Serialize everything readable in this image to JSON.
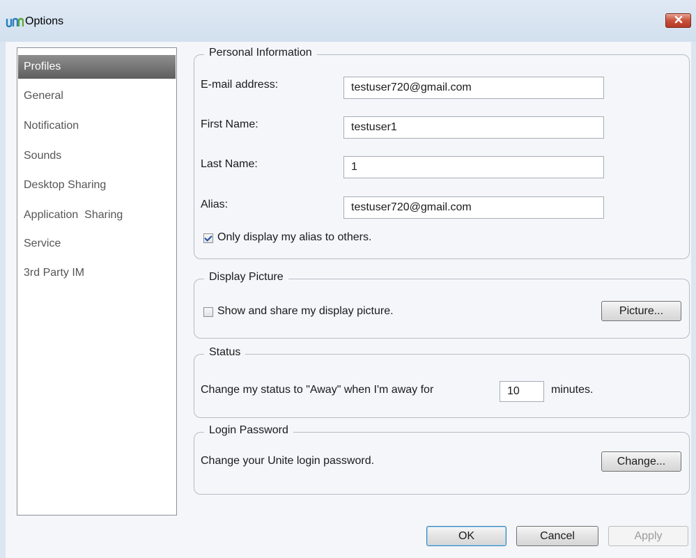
{
  "window": {
    "title": "Options",
    "app_icon": "unite-logo-icon",
    "close_icon": "close-icon"
  },
  "sidebar": {
    "items": [
      {
        "label": "Profiles",
        "selected": true
      },
      {
        "label": "General"
      },
      {
        "label": "Notification"
      },
      {
        "label": "Sounds"
      },
      {
        "label": "Desktop Sharing"
      },
      {
        "label": "Application  Sharing"
      },
      {
        "label": "Service"
      },
      {
        "label": "3rd Party IM"
      }
    ]
  },
  "personal_info": {
    "title": "Personal Information",
    "email_label": "E-mail address:",
    "email_value": "testuser720@gmail.com",
    "first_name_label": "First Name:",
    "first_name_value": "testuser1",
    "last_name_label": "Last Name:",
    "last_name_value": "1",
    "alias_label": "Alias:",
    "alias_value": "testuser720@gmail.com",
    "alias_only_label": "Only display my alias to others.",
    "alias_only_checked": true
  },
  "display_picture": {
    "title": "Display Picture",
    "share_label": "Show and share my display picture.",
    "share_checked": false,
    "picture_button": "Picture..."
  },
  "status": {
    "title": "Status",
    "prefix_text": "Change my status to \"Away\" when I'm away for",
    "minutes_value": "10",
    "suffix_text": "minutes."
  },
  "login_password": {
    "title": "Login Password",
    "description": "Change your Unite login password.",
    "change_button": "Change..."
  },
  "footer": {
    "ok_label": "OK",
    "cancel_label": "Cancel",
    "apply_label": "Apply"
  },
  "colors": {
    "selected_item": "#6e6e6e",
    "close_button": "#c9503a",
    "logo": "#2a7fbf"
  }
}
